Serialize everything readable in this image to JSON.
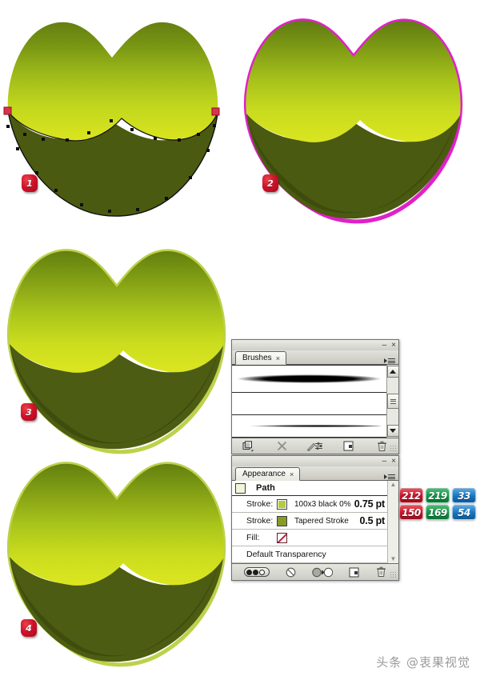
{
  "document": {
    "title": "Adobe Illustrator tutorial – green lips vector steps",
    "background_color": "#ffffff"
  },
  "steps": [
    {
      "number": "1",
      "caption_number": "1"
    },
    {
      "number": "2",
      "caption_number": "2"
    },
    {
      "number": "3",
      "caption_number": "3"
    },
    {
      "number": "4",
      "caption_number": "4"
    }
  ],
  "artwork": {
    "gradient_top": "#6c8c17",
    "gradient_mid": "#a3bc1b",
    "gradient_bottom": "#d8e21f",
    "shadow_fill": "#4a5a12",
    "inner_shadow": "#3c4a10",
    "highlight_rim": "#b9cf3b",
    "selection_stroke": "#1a1a1a",
    "anchor_point_color": "#121212",
    "endpoint_color": "#d9344f",
    "magenta_stroke": "#e021c8"
  },
  "brushes_panel": {
    "tab_label": "Brushes",
    "tab_close": "×",
    "minimize": "–",
    "close": "×",
    "panel_menu_name": "panel-menu-icon",
    "items": [
      {
        "name": "basic-thick-tapered-brush",
        "type": "art-brush"
      },
      {
        "name": "blank-brush-slot",
        "type": "empty"
      },
      {
        "name": "thin-tapered-brush",
        "type": "art-brush"
      }
    ],
    "scrollbar": {
      "up": "▲",
      "down": "▼"
    },
    "footer_buttons": [
      {
        "name": "brush-libraries-menu",
        "glyph": "❐"
      },
      {
        "name": "remove-brush-stroke",
        "glyph": "✕"
      },
      {
        "name": "options-of-selected-object",
        "glyph": "✐"
      },
      {
        "name": "new-brush",
        "glyph": "⧉"
      },
      {
        "name": "delete-brush",
        "glyph": "Ὕ1"
      }
    ]
  },
  "appearance_panel": {
    "tab_label": "Appearance",
    "tab_close": "×",
    "minimize": "–",
    "close": "×",
    "target_label": "Path",
    "rows": [
      {
        "label": "Stroke:",
        "swatch_color": "#b5cb3c",
        "brush_name": "100x3 black 0%",
        "weight": "0.75 pt"
      },
      {
        "label": "Stroke:",
        "swatch_color": "#8a9a27",
        "brush_name": "Tapered Stroke",
        "weight": "0.5 pt"
      },
      {
        "label": "Fill:",
        "swatch_color": "none",
        "brush_name": "",
        "weight": ""
      }
    ],
    "transparency_row": "Default Transparency",
    "footer_buttons": [
      {
        "name": "add-new-stroke-toggle",
        "glyph": "pill"
      },
      {
        "name": "clear-appearance",
        "glyph": "⊘"
      },
      {
        "name": "reduce-to-basic-appearance",
        "glyph": "◑"
      },
      {
        "name": "duplicate-selected-item",
        "glyph": "⧉"
      },
      {
        "name": "delete-selected-item",
        "glyph": "Ὕ1"
      }
    ]
  },
  "rgb_callout": {
    "label_name": "stroke-color-rgb-values",
    "rows": [
      {
        "r": "212",
        "g": "219",
        "b": "33"
      },
      {
        "r": "150",
        "g": "169",
        "b": "54"
      }
    ],
    "colors": {
      "red": "#c1132a",
      "green": "#149146",
      "blue": "#1673bd"
    }
  },
  "watermark": {
    "text": "头条 @衷果视觉"
  }
}
